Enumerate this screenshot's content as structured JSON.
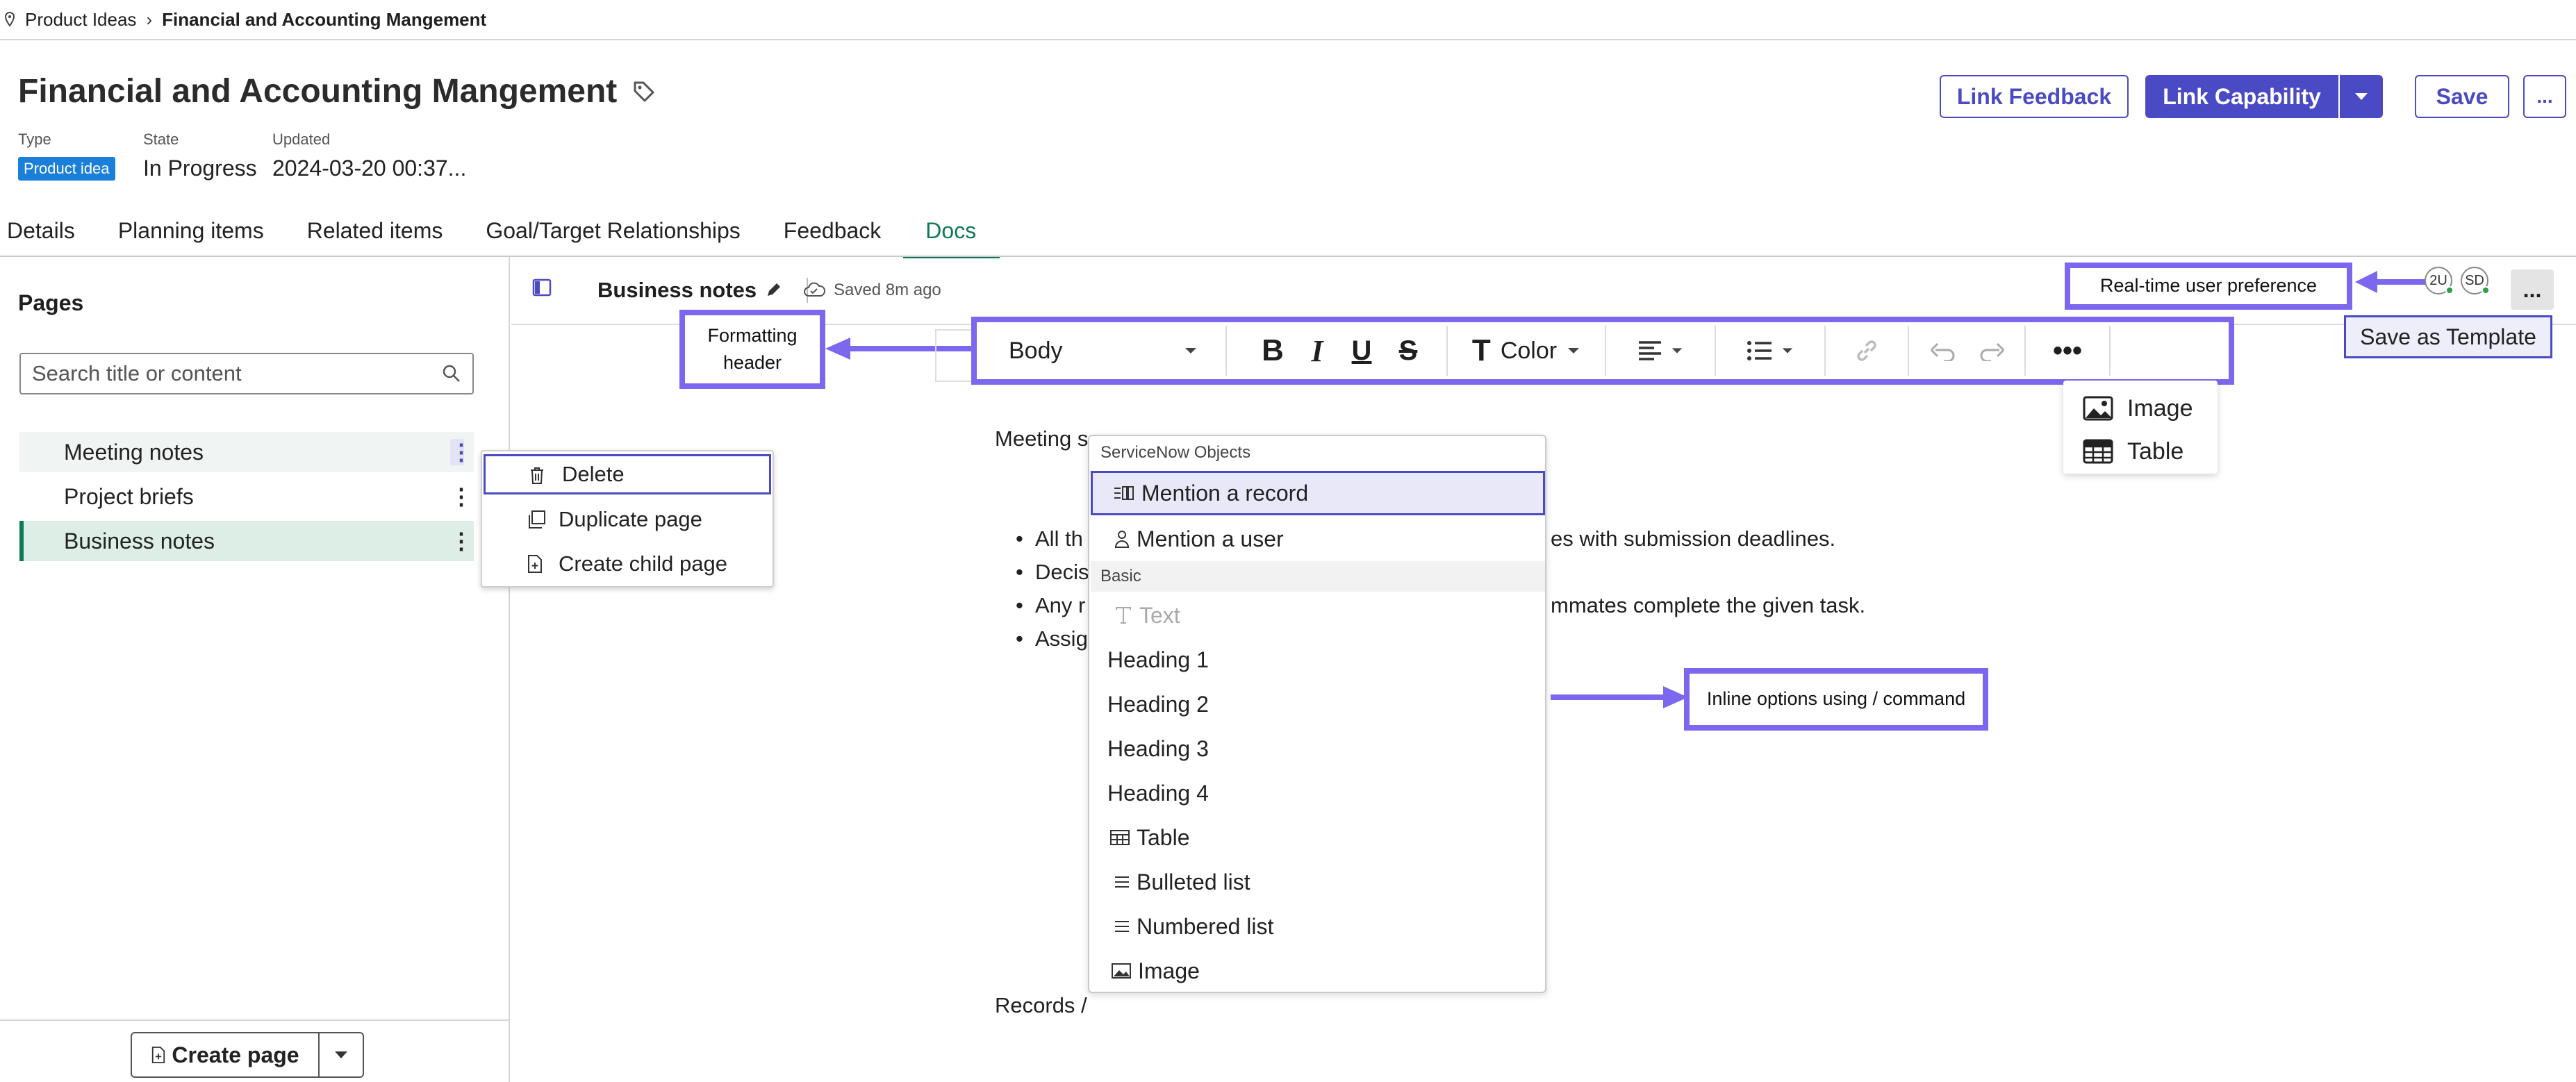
{
  "breadcrumb": {
    "parent": "Product Ideas",
    "current": "Financial and Accounting Mangement"
  },
  "header": {
    "title": "Financial and Accounting Mangement",
    "meta": [
      {
        "label": "Type",
        "value": "Product idea"
      },
      {
        "label": "State",
        "value": "In Progress"
      },
      {
        "label": "Updated",
        "value": "2024-03-20 00:37..."
      }
    ],
    "buttons": {
      "link_feedback": "Link Feedback",
      "link_capability": "Link Capability",
      "save": "Save",
      "more": "..."
    }
  },
  "tabs": [
    "Details",
    "Planning items",
    "Related items",
    "Goal/Target Relationships",
    "Feedback",
    "Docs"
  ],
  "active_tab": "Docs",
  "sidebar": {
    "heading": "Pages",
    "search_placeholder": "Search title or content",
    "pages": [
      "Meeting notes",
      "Project briefs",
      "Business notes"
    ],
    "selected_page": "Business notes",
    "create_page": "Create page"
  },
  "context_menu": [
    "Delete",
    "Duplicate page",
    "Create child page"
  ],
  "editor": {
    "doc_title": "Business notes",
    "saved_status": "Saved 8m ago",
    "text_style": "Body",
    "color_label": "Color",
    "avatars": [
      "2U",
      "SD"
    ],
    "more_button": "...",
    "save_as_template": "Save as Template",
    "meeting_prefix": "Meeting s",
    "bullets": [
      {
        "prefix": "All th",
        "suffix": "es with submission deadlines."
      },
      {
        "prefix": "Decis",
        "suffix": ""
      },
      {
        "prefix": "Any r",
        "suffix": "mmates complete the given task."
      },
      {
        "prefix": "Assig",
        "suffix": ""
      }
    ],
    "records_line": "Records /"
  },
  "insert_menu": [
    "Image",
    "Table"
  ],
  "slash_menu": {
    "groups": [
      {
        "name": "ServiceNow Objects",
        "items": [
          "Mention a record",
          "Mention a user"
        ]
      },
      {
        "name": "Basic",
        "items": [
          "Text",
          "Heading 1",
          "Heading 2",
          "Heading 3",
          "Heading 4",
          "Table",
          "Bulleted list",
          "Numbered list",
          "Image"
        ]
      }
    ],
    "selected": "Mention a record",
    "disabled": "Text"
  },
  "annotations": {
    "formatting_header": "Formatting header",
    "realtime": "Real-time user preference",
    "inline": "Inline options using / command"
  },
  "colors": {
    "accent": "#4a4ac4",
    "annotation": "#7b68ee",
    "active_tab": "#0e7a55",
    "badge": "#1a7fd9"
  }
}
